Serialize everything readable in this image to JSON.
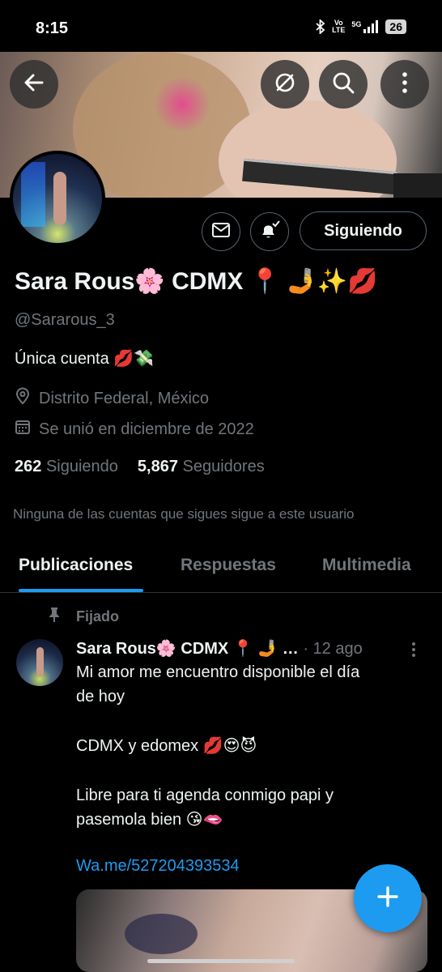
{
  "status_bar": {
    "time": "8:15",
    "volte_top": "Vo",
    "volte_bottom": "LTE",
    "network": "5G",
    "battery": "26"
  },
  "profile": {
    "name": "Sara Rous🌸 CDMX 📍 🤳✨💋",
    "handle": "@Sararous_3",
    "bio": "Única cuenta 💋💸",
    "location": "Distrito Federal, México",
    "joined": "Se unió en diciembre de 2022",
    "following_count": "262",
    "following_label": "Siguiendo",
    "followers_count": "5,867",
    "followers_label": "Seguidores",
    "follow_button_label": "Siguiendo",
    "mutuals_note": "Ninguna de las cuentas que sigues sigue a este usuario"
  },
  "tabs": [
    {
      "label": "Publicaciones",
      "active": true
    },
    {
      "label": "Respuestas",
      "active": false
    },
    {
      "label": "Multimedia",
      "active": false
    }
  ],
  "post": {
    "pinned_label": "Fijado",
    "author": "Sara Rous🌸 CDMX 📍 🤳 …",
    "time": "· 12 ago",
    "lines": [
      "Mi amor me encuentro disponible el día",
      "de hoy",
      " CDMX y edomex 💋😍😈",
      "Libre para ti agenda conmigo papi y",
      "pasemola bien 😘🫦"
    ],
    "link": "Wa.me/527204393534"
  },
  "colors": {
    "accent": "#1d9bf0",
    "background": "#000000",
    "secondary_text": "#71767b"
  },
  "icons": [
    "back-arrow-icon",
    "hide-icon",
    "search-icon",
    "more-vertical-icon",
    "mail-icon",
    "bell-check-icon",
    "location-pin-icon",
    "calendar-icon",
    "pin-icon",
    "plus-icon"
  ]
}
